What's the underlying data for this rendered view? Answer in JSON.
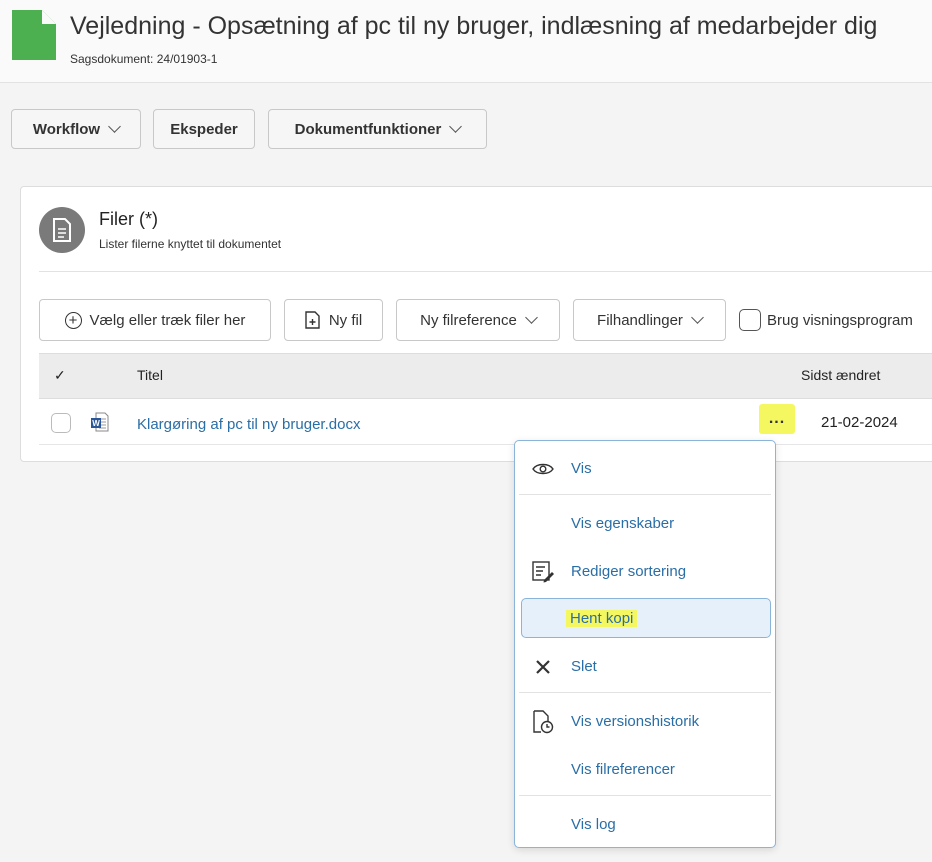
{
  "header": {
    "title": "Vejledning - Opsætning af pc til ny bruger, indlæsning af medarbejder dig",
    "subtitle": "Sagsdokument: 24/01903-1",
    "doc_icon_color": "#4caf50"
  },
  "toolbar": {
    "workflow_label": "Workflow",
    "ekspeder_label": "Ekspeder",
    "dokumentfunktioner_label": "Dokumentfunktioner"
  },
  "files_panel": {
    "title": "Filer (*)",
    "subtitle": "Lister filerne knyttet til dokumentet",
    "icon": "document-icon",
    "toolbar": {
      "choose_label": "Vælg eller træk filer her",
      "new_file_label": "Ny fil",
      "new_ref_label": "Ny filreference",
      "file_actions_label": "Filhandlinger",
      "viewer_label": "Brug visningsprogram"
    },
    "table": {
      "columns": {
        "check": "✓",
        "title": "Titel",
        "modified": "Sidst ændret"
      },
      "rows": [
        {
          "title": "Klargøring af pc til ny bruger.docx",
          "modified": "21-02-2024",
          "more": "...",
          "icon": "word-file-icon"
        }
      ]
    }
  },
  "context_menu": {
    "items": {
      "vis": "Vis",
      "vis_egenskaber": "Vis egenskaber",
      "rediger_sortering": "Rediger sortering",
      "hent_kopi": "Hent kopi",
      "slet": "Slet",
      "vis_versionshistorik": "Vis versionshistorik",
      "vis_filreferencer": "Vis filreferencer",
      "vis_log": "Vis log"
    }
  },
  "colors": {
    "link": "#2a6ea6",
    "highlight": "#f4f760",
    "menu_border": "#8ab4d8"
  }
}
